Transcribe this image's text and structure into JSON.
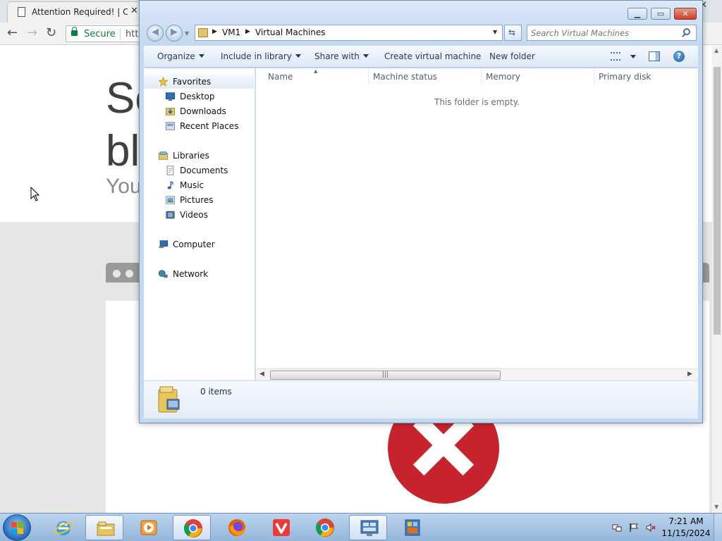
{
  "chrome": {
    "tab_title": "Attention Required! | Clo",
    "tab_close": "✕",
    "window_close": "✕",
    "secure_label": "Secure",
    "url_partial": "htt",
    "headline_line1": "So",
    "headline_line2": "bl",
    "subline": "You"
  },
  "explorer": {
    "breadcrumb": [
      "VM1",
      "Virtual Machines"
    ],
    "search_placeholder": "Search Virtual Machines",
    "window_buttons": {
      "minimize": "▁",
      "maximize": "▭",
      "close": "✕"
    },
    "commands": {
      "organize": "Organize",
      "include_in_library": "Include in library",
      "share_with": "Share with",
      "create_vm": "Create virtual machine",
      "new_folder": "New folder"
    },
    "help_glyph": "?",
    "nav": {
      "favorites": "Favorites",
      "desktop": "Desktop",
      "downloads": "Downloads",
      "recent_places": "Recent Places",
      "libraries": "Libraries",
      "documents": "Documents",
      "music": "Music",
      "pictures": "Pictures",
      "videos": "Videos",
      "computer": "Computer",
      "network": "Network"
    },
    "columns": [
      "Name",
      "Machine status",
      "Memory",
      "Primary disk"
    ],
    "empty_message": "This folder is empty.",
    "item_count": "0 items"
  },
  "taskbar": {
    "time": "7:21 AM",
    "date": "11/15/2024",
    "pinned": [
      "internet-explorer",
      "windows-explorer",
      "windows-media-player",
      "google-chrome",
      "firefox",
      "vivaldi",
      "google-chrome",
      "control-panel",
      "virtual-machines"
    ]
  },
  "colors": {
    "error_red": "#c7232d",
    "secure_green": "#0b8043",
    "window_frame": "#c3d9ef"
  }
}
